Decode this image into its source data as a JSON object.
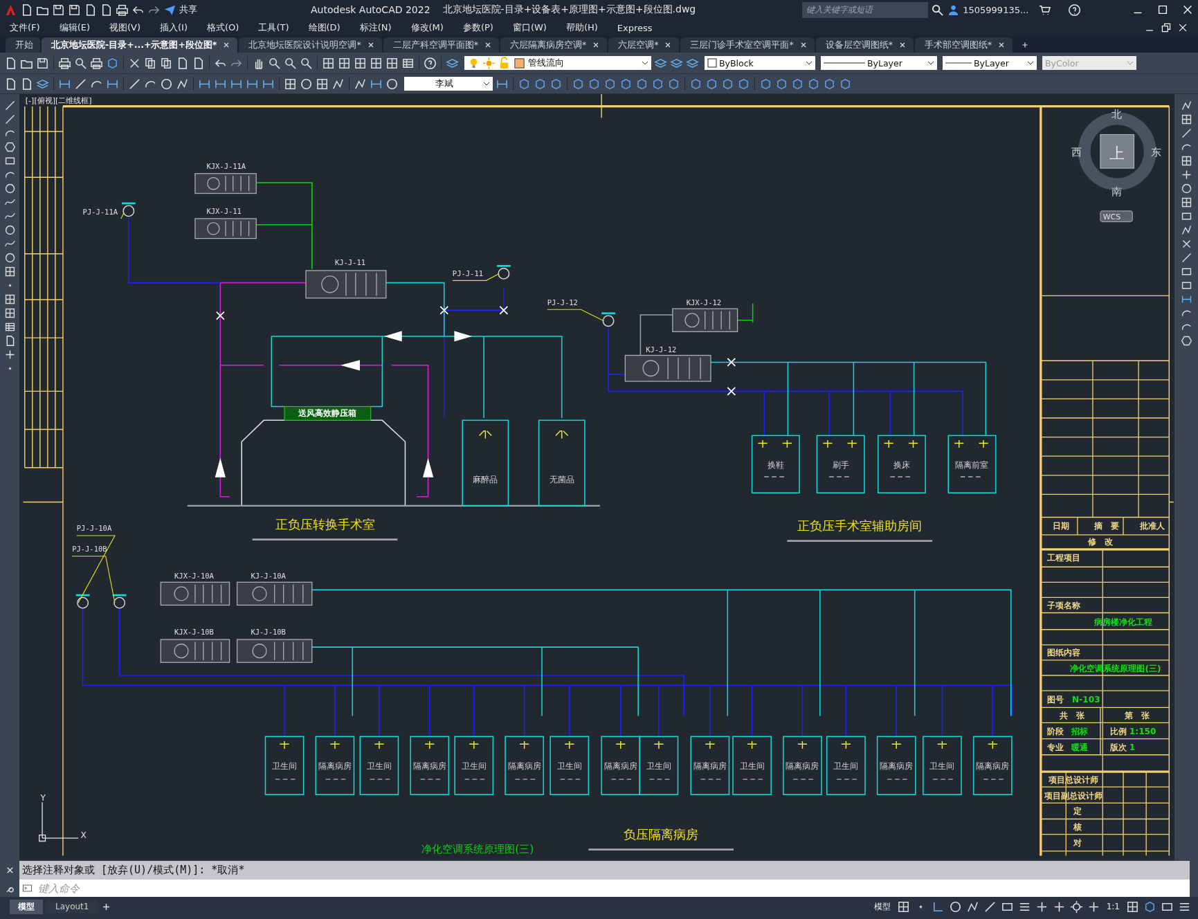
{
  "window": {
    "app_name": "Autodesk AutoCAD 2022",
    "file_name": "北京地坛医院-目录+设备表+原理图+示意图+段位图.dwg",
    "search_placeholder": "键入关键字或短语",
    "user": "1505999135..."
  },
  "quick_access": {
    "share": "共享"
  },
  "menu": [
    "文件(F)",
    "编辑(E)",
    "视图(V)",
    "插入(I)",
    "格式(O)",
    "工具(T)",
    "绘图(D)",
    "标注(N)",
    "修改(M)",
    "参数(P)",
    "窗口(W)",
    "帮助(H)",
    "Express"
  ],
  "tabs": [
    {
      "label": "开始",
      "selected": false,
      "closable": false
    },
    {
      "label": "北京地坛医院-目录+...+示意图+段位图*",
      "selected": true,
      "closable": true
    },
    {
      "label": "北京地坛医院设计说明空调*",
      "selected": false,
      "closable": true
    },
    {
      "label": "二层产科空调平面图*",
      "selected": false,
      "closable": true
    },
    {
      "label": "六层隔离病房空调*",
      "selected": false,
      "closable": true
    },
    {
      "label": "六层空调*",
      "selected": false,
      "closable": true
    },
    {
      "label": "三层门诊手术室空调平面*",
      "selected": false,
      "closable": true
    },
    {
      "label": "设备层空调图纸*",
      "selected": false,
      "closable": true
    },
    {
      "label": "手术部空调图纸*",
      "selected": false,
      "closable": true
    }
  ],
  "toolbar": {
    "layer": "管线流向",
    "dim_style": "李斌",
    "color_control": "ByBlock",
    "linetype": "ByLayer",
    "lineweight": "ByLayer",
    "plot_style": {
      "value": "ByColor",
      "disabled": true
    }
  },
  "viewport": {
    "label": "[-][俯视][二维线框]"
  },
  "viewcube": {
    "north": "北",
    "south": "南",
    "east": "东",
    "west": "西",
    "face": "上",
    "ucs": "WCS"
  },
  "drawing": {
    "units": [
      "KJX-J-11A",
      "KJX-J-11",
      "KJ-J-11",
      "KJX-J-12",
      "KJ-J-12",
      "KJX-J-10A",
      "KJ-J-10A",
      "KJX-J-10B",
      "KJ-J-10B"
    ],
    "fans": [
      "PJ-J-11A",
      "PJ-J-11",
      "PJ-J-12",
      "PJ-J-10A",
      "PJ-J-10B"
    ],
    "static_box": "送风高效静压箱",
    "or_rooms": [
      "麻醉品",
      "无菌品"
    ],
    "aux_rooms": [
      "换鞋",
      "刷手",
      "换床",
      "隔离前室"
    ],
    "ward_rooms": [
      "卫生间",
      "隔离病房",
      "卫生间",
      "隔离病房",
      "卫生间",
      "隔离病房",
      "卫生间",
      "隔离病房",
      "卫生间",
      "隔离病房",
      "卫生间",
      "隔离病房",
      "卫生间",
      "隔离病房",
      "卫生间",
      "隔离病房"
    ],
    "section_titles": [
      "正负压转换手术室",
      "正负压手术室辅助房间",
      "负压隔离病房"
    ],
    "sheet_title": "净化空调系统原理图(三)"
  },
  "title_block": [
    {
      "text": "日期",
      "kind": "label"
    },
    {
      "text": "摘　要",
      "kind": "label"
    },
    {
      "text": "批准人",
      "kind": "label"
    },
    {
      "text": "修　改",
      "kind": "label"
    },
    {
      "text": "工程项目",
      "kind": "label"
    },
    {
      "text": "子项名称",
      "kind": "label"
    },
    {
      "text": "病房楼净化工程",
      "kind": "value"
    },
    {
      "text": "图纸内容",
      "kind": "label"
    },
    {
      "text": "净化空调系统原理图(三)",
      "kind": "value"
    },
    {
      "text": "图号",
      "kind": "label"
    },
    {
      "text": "N-103",
      "kind": "value"
    },
    {
      "text": "共　张",
      "kind": "label"
    },
    {
      "text": "第　张",
      "kind": "label"
    },
    {
      "text": "阶段",
      "kind": "label"
    },
    {
      "text": "招标",
      "kind": "value"
    },
    {
      "text": "比例",
      "kind": "label"
    },
    {
      "text": "1:150",
      "kind": "value"
    },
    {
      "text": "专业",
      "kind": "label"
    },
    {
      "text": "暖通",
      "kind": "value"
    },
    {
      "text": "版次",
      "kind": "label"
    },
    {
      "text": "1",
      "kind": "value"
    },
    {
      "text": "项目总设计师",
      "kind": "label"
    },
    {
      "text": "项目副总设计师",
      "kind": "label"
    },
    {
      "text": "定",
      "kind": "label"
    },
    {
      "text": "核",
      "kind": "label"
    },
    {
      "text": "对",
      "kind": "label"
    }
  ],
  "ucs": {
    "x": "X",
    "y": "Y"
  },
  "command_line": {
    "history": "选择注释对象或 [放弃(U)/模式(M)]: *取消*",
    "placeholder": "键入命令"
  },
  "layout_tabs": [
    {
      "label": "模型",
      "selected": true
    },
    {
      "label": "Layout1",
      "selected": false
    }
  ],
  "status_bar": {
    "space": "模型",
    "scale": "1:1"
  }
}
